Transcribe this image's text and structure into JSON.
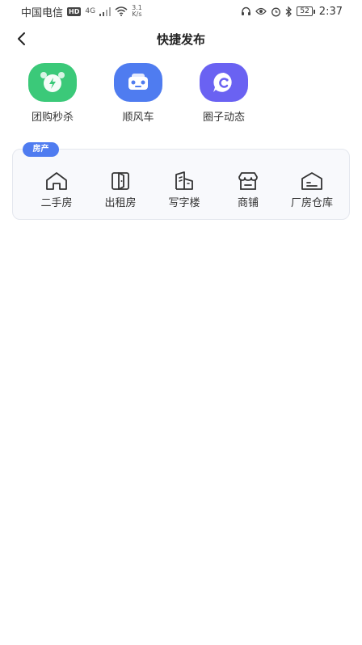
{
  "status": {
    "carrier": "中国电信",
    "hd": "HD",
    "network": "4G",
    "speed_value": "3.1",
    "speed_unit": "K/s",
    "battery": "52",
    "time": "2:37"
  },
  "nav": {
    "title": "快捷发布"
  },
  "quick_actions": [
    {
      "label": "团购秒杀",
      "icon": "alarm-clock-bolt-icon",
      "color": "#3bc979"
    },
    {
      "label": "顺风车",
      "icon": "car-icon",
      "color": "#4f7cf0"
    },
    {
      "label": "圈子动态",
      "icon": "chat-bubble-icon",
      "color": "#6a62f2"
    }
  ],
  "real_estate": {
    "tag": "房产",
    "items": [
      {
        "label": "二手房",
        "icon": "house-icon"
      },
      {
        "label": "出租房",
        "icon": "door-icon"
      },
      {
        "label": "写字楼",
        "icon": "office-building-icon"
      },
      {
        "label": "商铺",
        "icon": "shop-awning-icon"
      },
      {
        "label": "厂房仓库",
        "icon": "warehouse-icon"
      }
    ]
  }
}
